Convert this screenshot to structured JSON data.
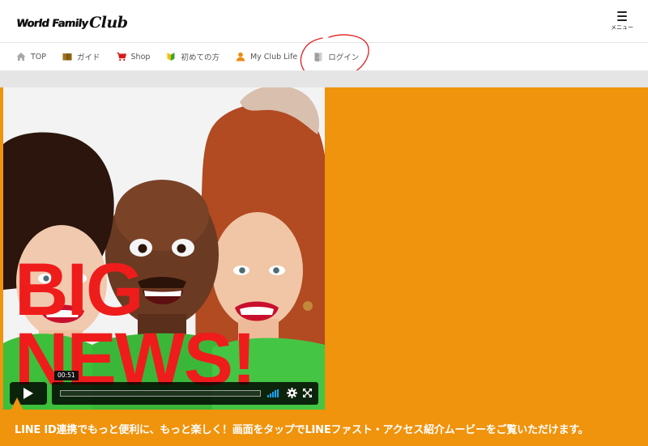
{
  "header": {
    "logo_main": "World Family",
    "logo_club": "Club",
    "menu_label": "メニュー"
  },
  "nav": {
    "items": [
      {
        "label": "TOP",
        "icon": "home-icon",
        "color": "#999999"
      },
      {
        "label": "ガイド",
        "icon": "book-icon",
        "color": "#a0741c"
      },
      {
        "label": "Shop",
        "icon": "cart-icon",
        "color": "#d61a1a"
      },
      {
        "label": "初めての方",
        "icon": "beginner-mark-icon",
        "color": "#3aa536"
      },
      {
        "label": "My Club Life",
        "icon": "user-icon",
        "color": "#ee8a10"
      },
      {
        "label": "ログイン",
        "icon": "login-door-icon",
        "color": "#aaaaaa"
      }
    ]
  },
  "hero": {
    "background": "#f0930d",
    "video": {
      "headline_line1": "BIG",
      "headline_line2": "NEWS!",
      "time": "00:51",
      "progress": 0
    },
    "caption": "LINE ID連携でもっと便利に、もっと楽しく！画面をタップでLINEファスト・アクセス紹介ムービーをご覧いただけます。"
  },
  "colors": {
    "accent_orange": "#f0930d",
    "headline_red": "#ef1c1c",
    "shirt_green": "#3dbf3b",
    "annotation_red": "#e0201e",
    "volume_blue": "#19a4ff"
  }
}
